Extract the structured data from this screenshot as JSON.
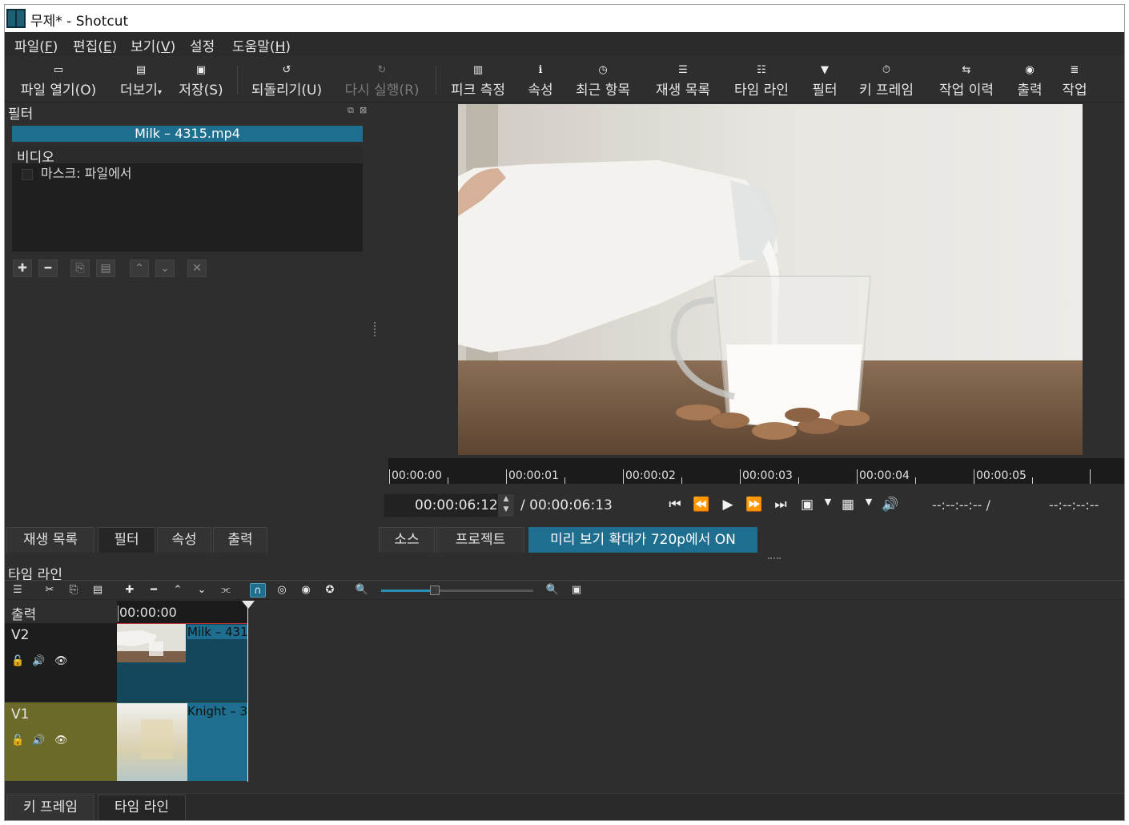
{
  "window": {
    "title": "무제* - Shotcut"
  },
  "menu": [
    {
      "label": "파일(",
      "mnemonic": "F",
      "suffix": ")"
    },
    {
      "label": "편집(",
      "mnemonic": "E",
      "suffix": ")"
    },
    {
      "label": "보기(",
      "mnemonic": "V",
      "suffix": ")"
    },
    {
      "label": "설정",
      "mnemonic": "",
      "suffix": ""
    },
    {
      "label": "도움말(",
      "mnemonic": "H",
      "suffix": ")"
    }
  ],
  "toolbar": {
    "open_file": "파일 열기(O)",
    "more": "더보기",
    "save": "저장(S)",
    "undo": "되돌리기(U)",
    "redo": "다시 실행(R)",
    "peak_meter": "피크 측정",
    "properties": "속성",
    "recent": "최근 항목",
    "playlist": "재생 목록",
    "timeline": "타임 라인",
    "filters": "필터",
    "keyframes": "키 프레임",
    "history": "작업 이력",
    "export": "출력",
    "jobs": "작업"
  },
  "filters_panel": {
    "title": "필터",
    "clip_name": "Milk – 4315.mp4",
    "section": "비디오",
    "items": [
      {
        "label": "마스크: 파일에서",
        "checked": false
      }
    ]
  },
  "player": {
    "ruler_labels": [
      "00:00:00",
      "00:00:01",
      "00:00:02",
      "00:00:03",
      "00:00:04",
      "00:00:05"
    ],
    "position": "00:00:06:12",
    "duration": "/ 00:00:06:13",
    "in_point": "--:--:--:-- /",
    "out_point": "--:--:--:--"
  },
  "left_tabs": [
    "재생 목록",
    "필터",
    "속성",
    "출력"
  ],
  "right_tabs": [
    "소스",
    "프로젝트"
  ],
  "preview_scaling_badge": "미리 보기 확대가 720p에서 ON",
  "timeline": {
    "title": "타임 라인",
    "output_label": "출력",
    "start_time": "00:00:00",
    "zoom": 0.35,
    "tracks": [
      {
        "name": "V2",
        "clip": "Milk – 431"
      },
      {
        "name": "V1",
        "clip": "Knight – 3"
      }
    ]
  },
  "bottom_tabs": [
    "키 프레임",
    "타임 라인"
  ],
  "colors": {
    "accent": "#1e6f8f",
    "v1_track": "#6b6a28",
    "clip_border": "#c53434"
  }
}
